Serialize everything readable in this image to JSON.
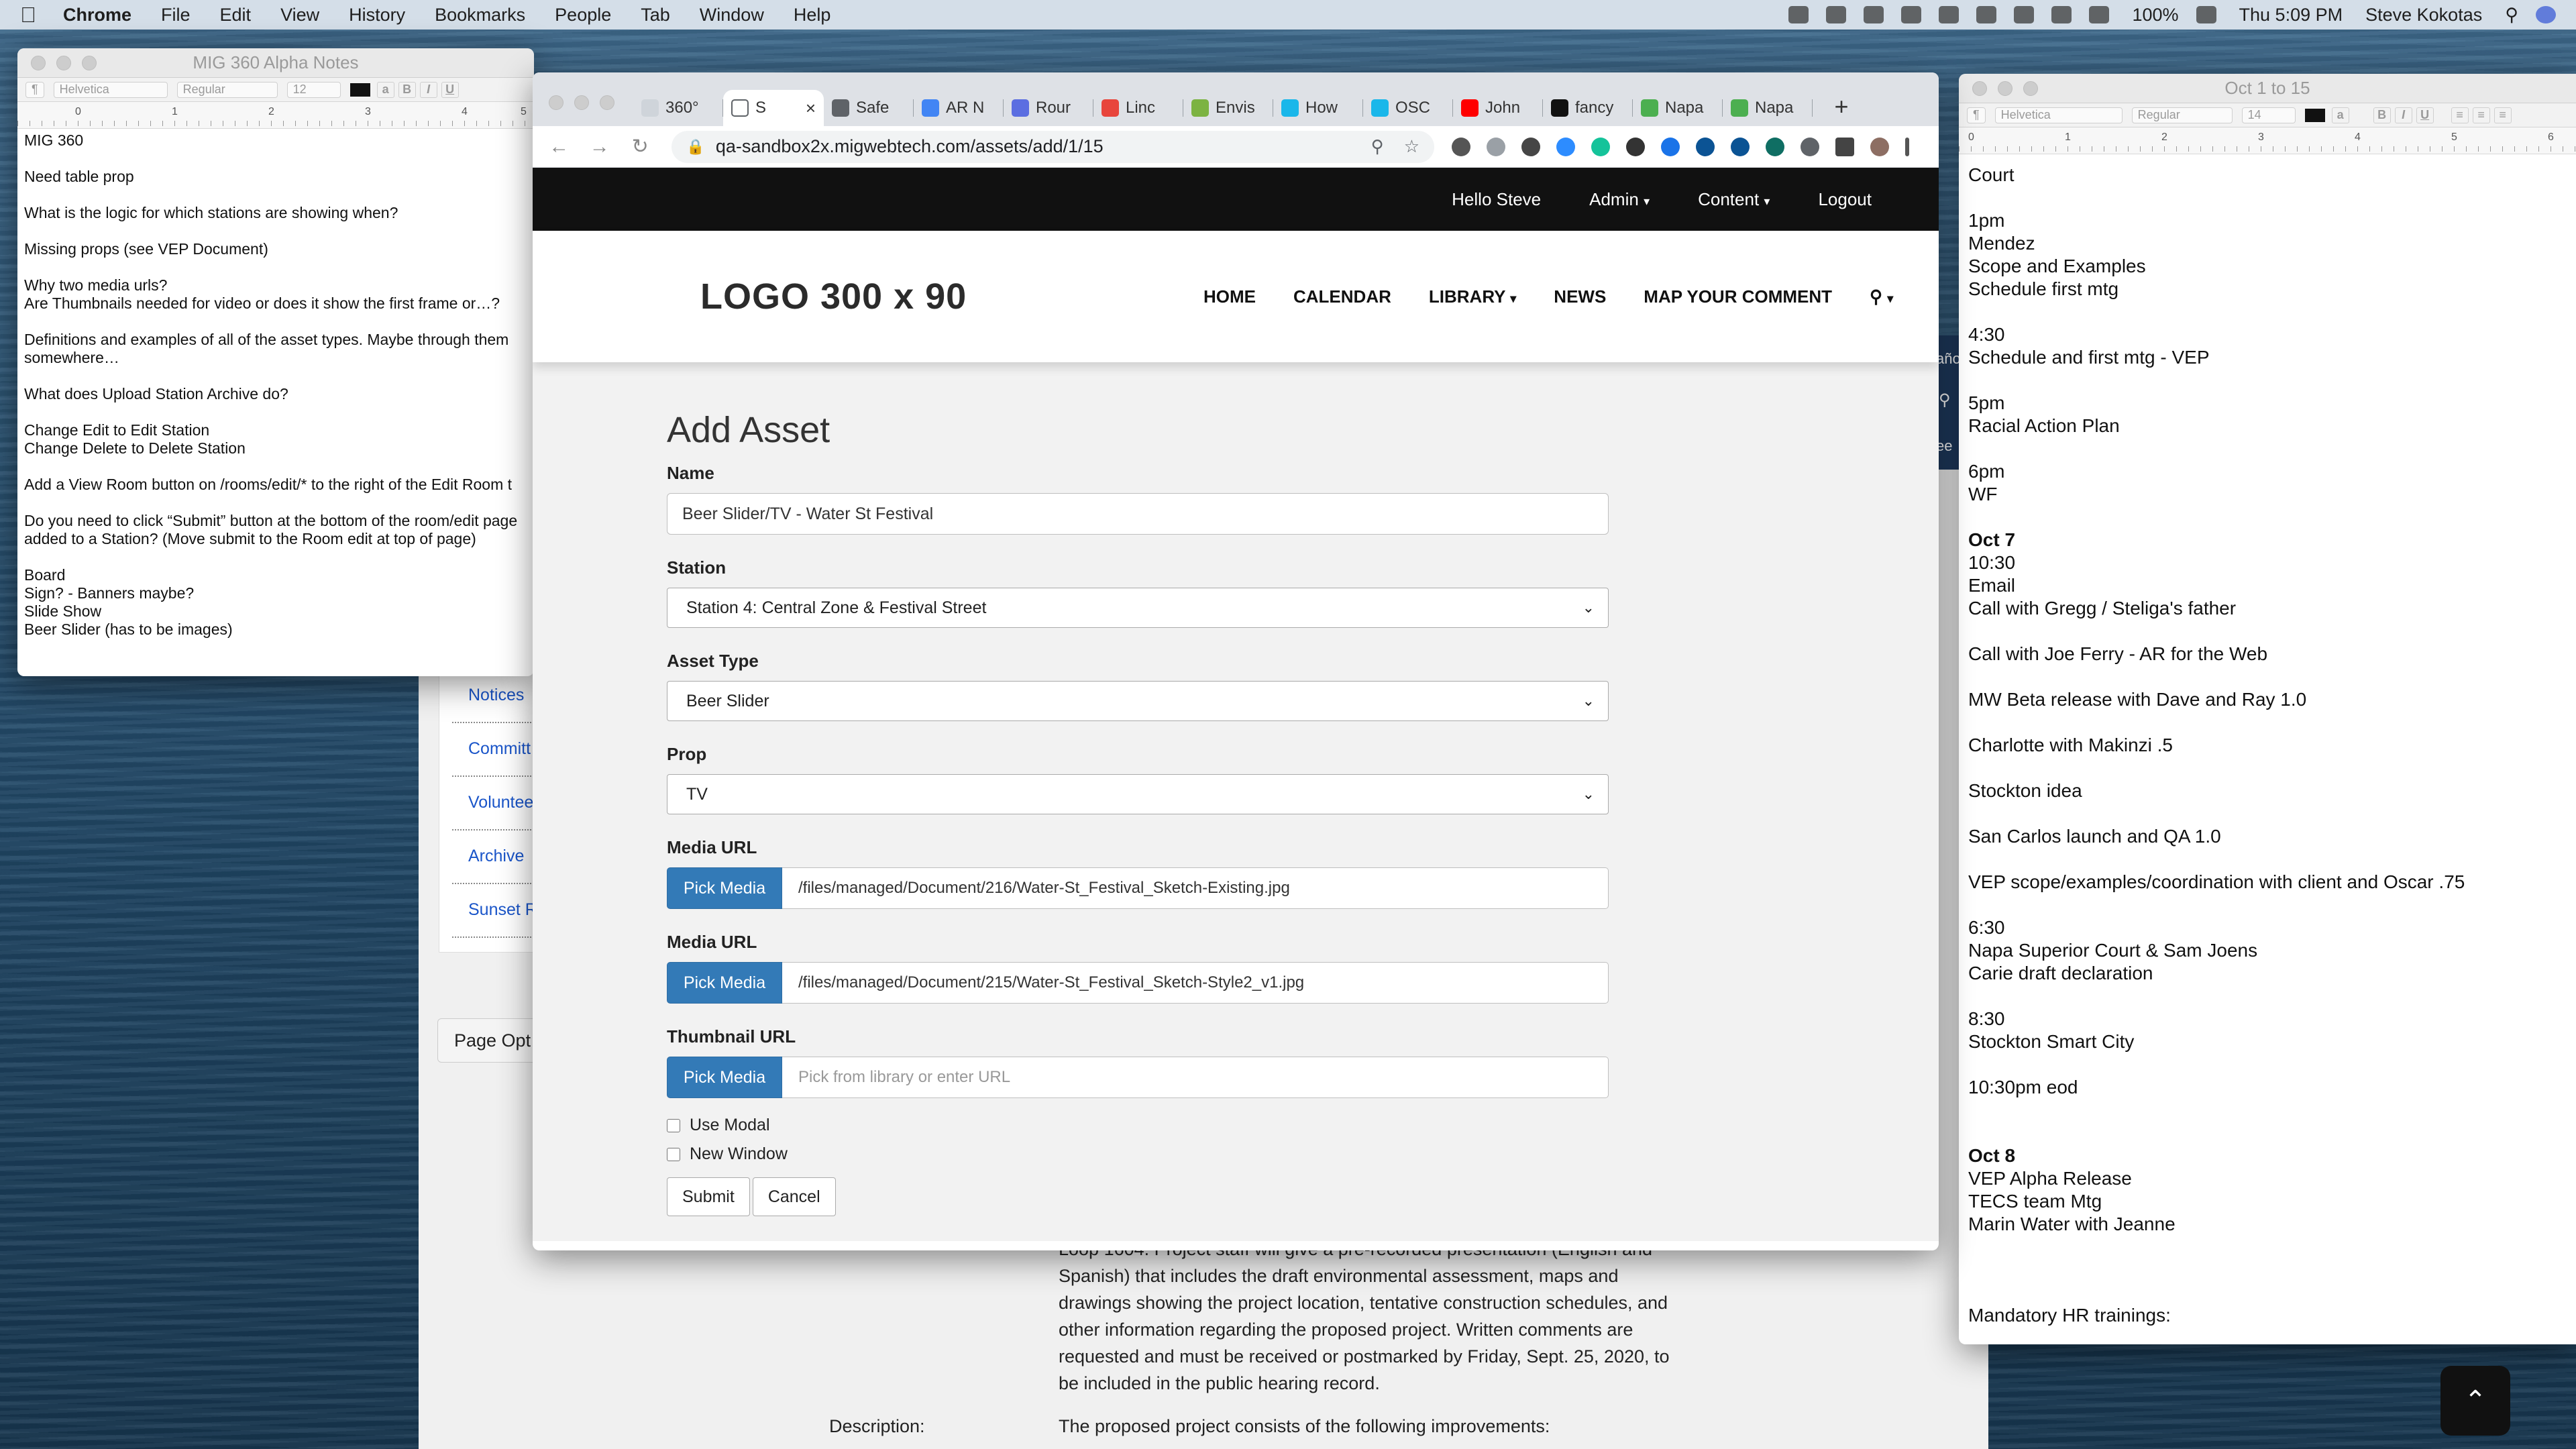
{
  "menubar": {
    "app": "Chrome",
    "items": [
      "File",
      "Edit",
      "View",
      "History",
      "Bookmarks",
      "People",
      "Tab",
      "Window",
      "Help"
    ],
    "battery": "100%",
    "clock": "Thu 5:09 PM",
    "user": "Steve Kokotas"
  },
  "notes_window": {
    "title": "MIG 360 Alpha Notes",
    "font": "Helvetica",
    "style": "Regular",
    "size": "12",
    "ruler": [
      "0",
      "1",
      "2",
      "3",
      "4",
      "5"
    ],
    "lines": [
      "MIG 360",
      "",
      "Need table prop",
      "",
      "What is the logic for which stations are showing when?",
      "",
      "Missing props (see VEP Document)",
      "",
      "Why two media urls?",
      "Are Thumbnails needed for video or does it show the first frame or…?",
      "",
      "Definitions and examples of all of the asset types. Maybe through them",
      "somewhere…",
      "",
      "What does Upload Station Archive do?",
      "",
      "Change Edit to Edit Station",
      "Change Delete to Delete Station",
      "",
      "Add a View Room button on /rooms/edit/* to the right of the Edit Room t",
      "",
      "Do you need to click “Submit” button at the bottom of the room/edit page",
      "added to a Station? (Move submit to the Room edit at top of page)",
      "",
      "Board",
      "Sign? - Banners maybe?",
      "Slide Show",
      "Beer Slider (has to be images)"
    ]
  },
  "chrome": {
    "tabs": [
      {
        "label": "360°",
        "color": "#cfd4da"
      },
      {
        "label": "S",
        "color": "#ffffff"
      },
      {
        "label": "Safe",
        "color": "#5f6368"
      },
      {
        "label": "AR N",
        "color": "#4285f4"
      },
      {
        "label": "Rour",
        "color": "#5b6ee1"
      },
      {
        "label": "Linc",
        "color": "#e8453c"
      },
      {
        "label": "Envis",
        "color": "#7cb342"
      },
      {
        "label": "How",
        "color": "#1ab7ea"
      },
      {
        "label": "OSC",
        "color": "#1ab7ea"
      },
      {
        "label": "John",
        "color": "#ff0000"
      },
      {
        "label": "fancy",
        "color": "#111111"
      },
      {
        "label": "Napa",
        "color": "#4caf50"
      },
      {
        "label": "Napa",
        "color": "#4caf50"
      }
    ],
    "active_tab_close": "×",
    "new_tab": "+",
    "url": "qa-sandbox2x.migwebtech.com/assets/add/1/15"
  },
  "site": {
    "topbar": {
      "greeting": "Hello Steve",
      "admin": "Admin",
      "content": "Content",
      "logout": "Logout"
    },
    "logo": "LOGO 300 x 90",
    "nav": [
      "HOME",
      "CALENDAR",
      "LIBRARY",
      "NEWS",
      "MAP YOUR COMMENT"
    ],
    "form": {
      "title": "Add Asset",
      "name_label": "Name",
      "name_value": "Beer Slider/TV - Water St Festival",
      "station_label": "Station",
      "station_value": "Station 4: Central Zone & Festival Street",
      "asset_type_label": "Asset Type",
      "asset_type_value": "Beer Slider",
      "prop_label": "Prop",
      "prop_value": "TV",
      "media1_label": "Media URL",
      "media1_value": "/files/managed/Document/216/Water-St_Festival_Sketch-Existing.jpg",
      "media2_label": "Media URL",
      "media2_value": "/files/managed/Document/215/Water-St_Festival_Sketch-Style2_v1.jpg",
      "thumb_label": "Thumbnail URL",
      "thumb_placeholder": "Pick from library or enter URL",
      "pick_label": "Pick Media",
      "use_modal": "Use Modal",
      "new_window": "New Window",
      "submit": "Submit",
      "cancel": "Cancel"
    }
  },
  "background_page": {
    "sidebar_links": [
      "Notices",
      "Committ",
      "Voluntee",
      "Archive",
      "Sunset R"
    ],
    "page_options": "Page Opt",
    "peek_labels": [
      "año",
      "ee"
    ],
    "body_lines": [
      "Loop 1604. Project staff will give a pre-recorded presentation (English and",
      "Spanish) that includes the draft environmental assessment, maps and",
      "drawings showing the project location, tentative construction schedules, and",
      "other information regarding the proposed project. Written comments are",
      "requested and must be received or postmarked by Friday, Sept. 25, 2020, to",
      "be included in the public hearing record."
    ],
    "description_label": "Description:",
    "description_text": "The proposed project consists of the following improvements:"
  },
  "notes2_window": {
    "title": "Oct 1 to 15",
    "font": "Helvetica",
    "style": "Regular",
    "size": "14",
    "ruler": [
      "0",
      "1",
      "2",
      "3",
      "4",
      "5",
      "6"
    ],
    "lines": [
      {
        "t": "Court"
      },
      {
        "t": ""
      },
      {
        "t": "1pm"
      },
      {
        "t": "Mendez"
      },
      {
        "t": "Scope and Examples"
      },
      {
        "t": "Schedule first mtg"
      },
      {
        "t": ""
      },
      {
        "t": "4:30"
      },
      {
        "t": "Schedule and first mtg - VEP"
      },
      {
        "t": ""
      },
      {
        "t": "5pm"
      },
      {
        "t": "Racial Action Plan"
      },
      {
        "t": ""
      },
      {
        "t": "6pm"
      },
      {
        "t": "WF"
      },
      {
        "t": ""
      },
      {
        "t": "Oct 7",
        "b": true
      },
      {
        "t": "10:30"
      },
      {
        "t": "Email"
      },
      {
        "t": "Call with Gregg / Steliga's father"
      },
      {
        "t": ""
      },
      {
        "t": "Call with Joe Ferry - AR for the Web"
      },
      {
        "t": ""
      },
      {
        "t": "MW Beta release with Dave and Ray 1.0"
      },
      {
        "t": ""
      },
      {
        "t": "Charlotte with Makinzi .5"
      },
      {
        "t": ""
      },
      {
        "t": "Stockton idea"
      },
      {
        "t": ""
      },
      {
        "t": "San Carlos launch and QA 1.0"
      },
      {
        "t": ""
      },
      {
        "t": "VEP scope/examples/coordination with client and Oscar .75"
      },
      {
        "t": ""
      },
      {
        "t": "6:30"
      },
      {
        "t": "Napa Superior Court & Sam Joens"
      },
      {
        "t": "Carie draft declaration"
      },
      {
        "t": ""
      },
      {
        "t": "8:30"
      },
      {
        "t": "Stockton Smart City"
      },
      {
        "t": ""
      },
      {
        "t": "10:30pm eod"
      },
      {
        "t": ""
      },
      {
        "t": ""
      },
      {
        "t": "Oct 8",
        "b": true
      },
      {
        "t": "VEP Alpha Release"
      },
      {
        "t": "TECS team Mtg"
      },
      {
        "t": "Marin Water with Jeanne"
      },
      {
        "t": ""
      },
      {
        "t": ""
      },
      {
        "t": ""
      },
      {
        "t": "Mandatory HR trainings:"
      }
    ]
  },
  "scroll_top_icon": "chevron-up-icon"
}
